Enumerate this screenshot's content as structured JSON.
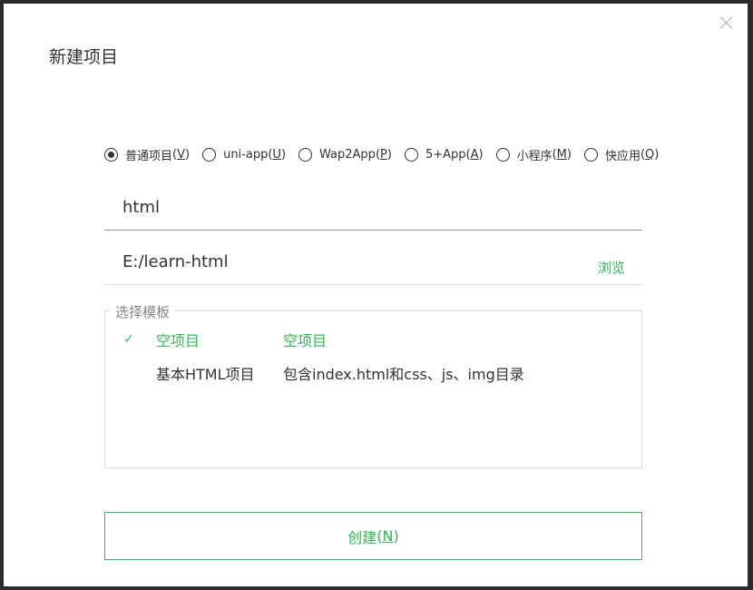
{
  "dialog": {
    "title": "新建项目"
  },
  "project_types": [
    {
      "label": "普通项目",
      "key": "V",
      "selected": true
    },
    {
      "label": "uni-app",
      "key": "U",
      "selected": false
    },
    {
      "label": "Wap2App",
      "key": "P",
      "selected": false
    },
    {
      "label": "5+App",
      "key": "A",
      "selected": false
    },
    {
      "label": "小程序",
      "key": "M",
      "selected": false
    },
    {
      "label": "快应用",
      "key": "Q",
      "selected": false
    }
  ],
  "name_value": "html",
  "path_value": "E:/learn-html",
  "browse_label": "浏览",
  "template": {
    "legend": "选择模板",
    "items": [
      {
        "name": "空项目",
        "desc": "空项目",
        "selected": true
      },
      {
        "name": "基本HTML项目",
        "desc": "包含index.html和css、js、img目录",
        "selected": false
      }
    ]
  },
  "create": {
    "label": "创建",
    "key": "N"
  },
  "colors": {
    "accent": "#2dbb55"
  }
}
